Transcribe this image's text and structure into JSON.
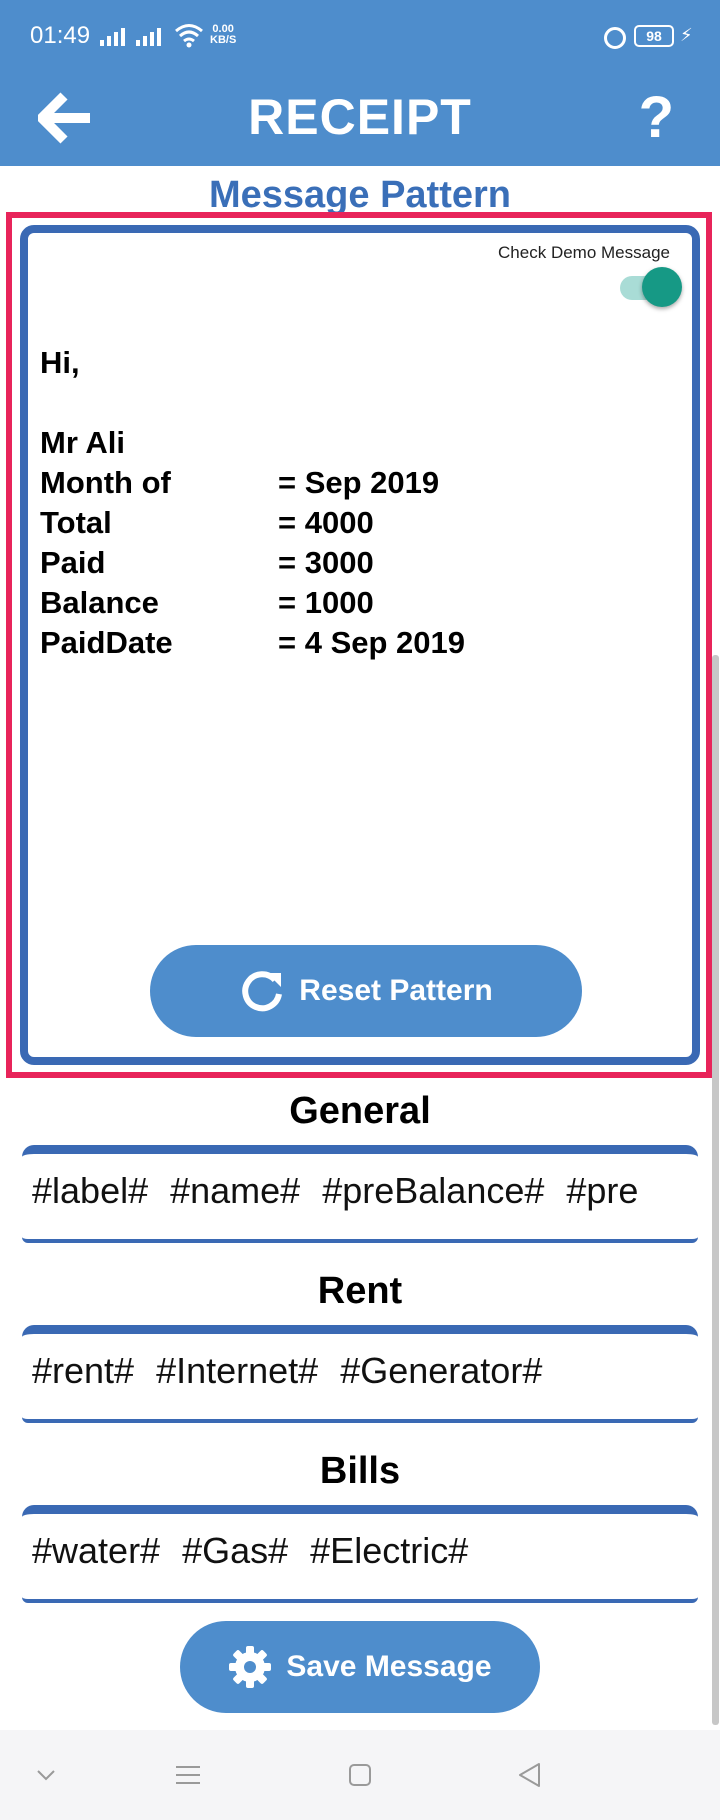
{
  "status_bar": {
    "time": "01:49",
    "net_speed_value": "0.00",
    "net_speed_unit": "KB/S",
    "battery": "98"
  },
  "header": {
    "title": "RECEIPT",
    "help_label": "?"
  },
  "pattern": {
    "title": "Message Pattern",
    "demo_toggle_label": "Check Demo Message",
    "demo_toggle_on": true,
    "greeting": "Hi,",
    "name": "Mr Ali",
    "rows": [
      {
        "label": "Month of",
        "value": "= Sep 2019"
      },
      {
        "label": "Total",
        "value": "= 4000"
      },
      {
        "label": "Paid",
        "value": "= 3000"
      },
      {
        "label": "Balance",
        "value": "= 1000"
      },
      {
        "label": "PaidDate",
        "value": "= 4 Sep 2019"
      }
    ],
    "reset_label": "Reset Pattern"
  },
  "groups": {
    "general": {
      "title": "General",
      "tags": [
        "#label#",
        "#name#",
        "#preBalance#",
        "#pre"
      ]
    },
    "rent": {
      "title": "Rent",
      "tags": [
        "#rent#",
        "#Internet#",
        "#Generator#"
      ]
    },
    "bills": {
      "title": "Bills",
      "tags": [
        "#water#",
        "#Gas#",
        "#Electric#"
      ]
    }
  },
  "save_label": "Save Message",
  "colors": {
    "primary": "#4E8DCC",
    "card_border": "#3A69B4",
    "highlight": "#E8245A",
    "toggle": "#169985"
  }
}
